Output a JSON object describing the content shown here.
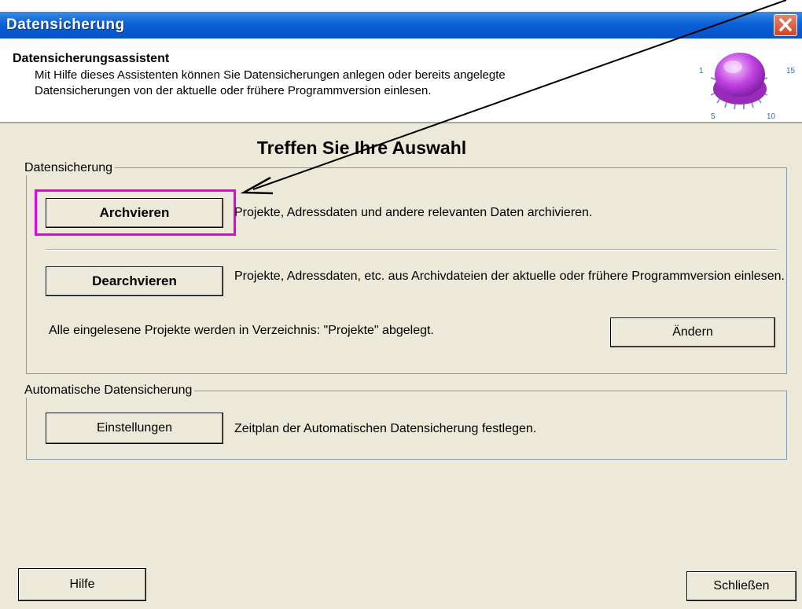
{
  "window": {
    "title": "Datensicherung"
  },
  "header": {
    "title": "Datensicherungsassistent",
    "description": "Mit Hilfe dieses Assistenten können Sie Datensicherungen anlegen oder bereits angelegte Datensicherungen von der aktuelle oder frühere Programmversion einlesen.",
    "knob_scale": [
      "1",
      "5",
      "10",
      "15"
    ]
  },
  "main": {
    "heading": "Treffen Sie Ihre Auswahl",
    "backup_group": {
      "legend": "Datensicherung",
      "archive_button": "Archvieren",
      "archive_text": "Projekte, Adressdaten und andere relevanten Daten archivieren.",
      "dearchive_button": "Dearchvieren",
      "dearchive_text": "Projekte, Adressdaten, etc. aus Archivdateien der aktuelle oder frühere Programmversion einlesen.",
      "directory_text": "Alle eingelesene Projekte werden in Verzeichnis: \"Projekte\" abgelegt.",
      "change_button": "Ändern"
    },
    "auto_group": {
      "legend": "Automatische Datensicherung",
      "settings_button": "Einstellungen",
      "settings_text": "Zeitplan der Automatischen Datensicherung festlegen."
    }
  },
  "footer": {
    "help_button": "Hilfe",
    "close_button": "Schließen"
  },
  "colors": {
    "titlebar": "#0a5fd8",
    "highlight": "#e600e6",
    "dialog_bg": "#ece9d8",
    "knob": "#c040e0"
  }
}
